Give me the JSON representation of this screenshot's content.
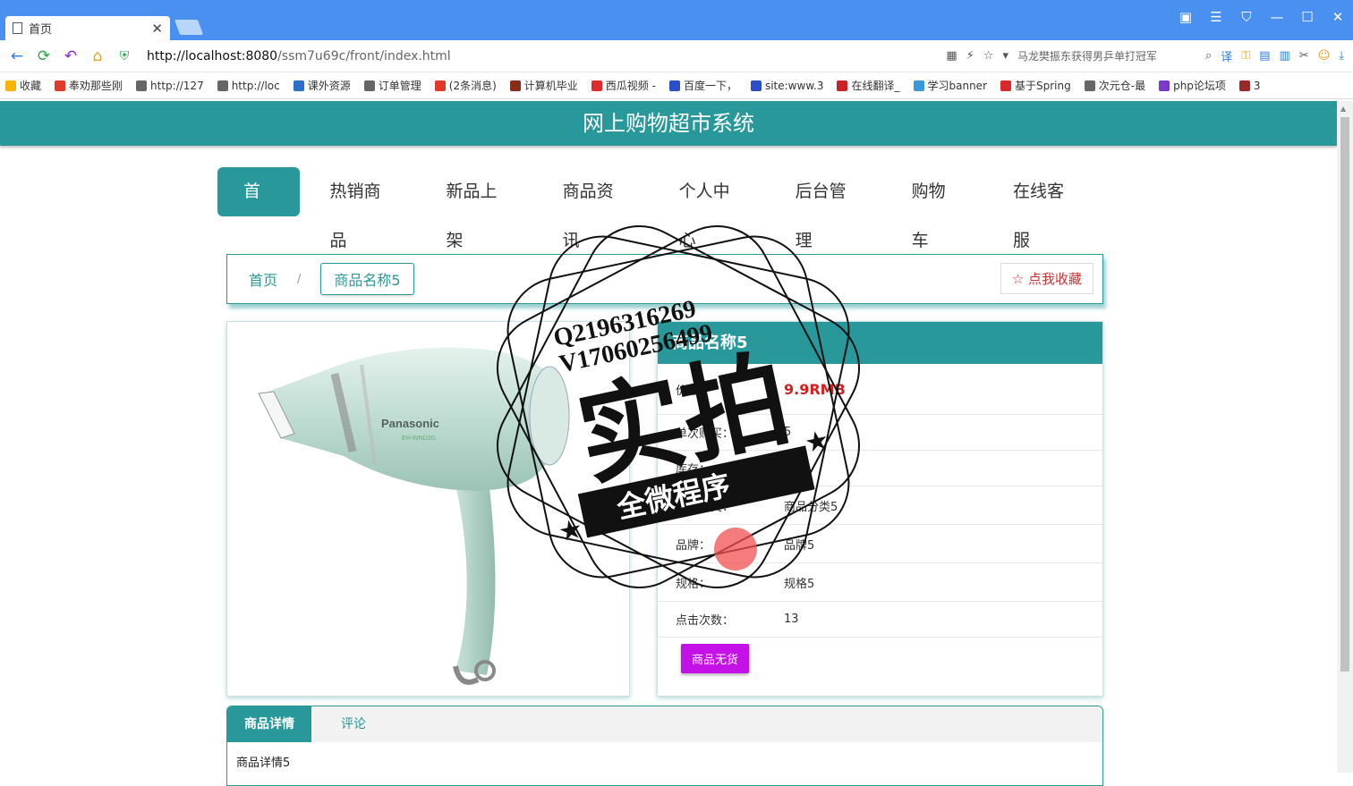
{
  "browser": {
    "tab_title": "首页",
    "url_host": "http://localhost:8080",
    "url_path": "/ssm7u69c/front/index.html",
    "search_text": "马龙樊振东获得男乒单打冠军"
  },
  "bookmarks": [
    {
      "label": "收藏",
      "color": "#f5b400"
    },
    {
      "label": "奉劝那些刚",
      "color": "#e03a2a"
    },
    {
      "label": "http://127",
      "color": "#666666"
    },
    {
      "label": "http://loc",
      "color": "#666666"
    },
    {
      "label": "课外资源",
      "color": "#2a6fc9"
    },
    {
      "label": "订单管理",
      "color": "#666666"
    },
    {
      "label": "(2条消息)",
      "color": "#e03a2a"
    },
    {
      "label": "计算机毕业",
      "color": "#8a2a1a"
    },
    {
      "label": "西瓜视频 -",
      "color": "#e02a2a"
    },
    {
      "label": "百度一下，",
      "color": "#2a4fc9"
    },
    {
      "label": "site:www.3",
      "color": "#2a4fc9"
    },
    {
      "label": "在线翻译_",
      "color": "#c9202a"
    },
    {
      "label": "学习banner",
      "color": "#3a9ad9"
    },
    {
      "label": "基于Spring",
      "color": "#d92a2a"
    },
    {
      "label": "次元仓-最",
      "color": "#666666"
    },
    {
      "label": "php论坛项",
      "color": "#7a3ac9"
    },
    {
      "label": "3",
      "color": "#9a2a2a"
    }
  ],
  "site": {
    "title": "网上购物超市系统"
  },
  "nav": [
    {
      "label": "首页",
      "active": true
    },
    {
      "label": "热销商品",
      "active": false
    },
    {
      "label": "新品上架",
      "active": false
    },
    {
      "label": "商品资讯",
      "active": false
    },
    {
      "label": "个人中心",
      "active": false
    },
    {
      "label": "后台管理",
      "active": false
    },
    {
      "label": "购物车",
      "active": false
    },
    {
      "label": "在线客服",
      "active": false
    }
  ],
  "breadcrumb": {
    "home": "首页",
    "separator": "/",
    "current": "商品名称5",
    "favorite": "☆ 点我收藏"
  },
  "product": {
    "title": "商品名称5",
    "image_brand": "Panasonic",
    "image_model": "EH-WND2G",
    "rows": [
      {
        "label": "价格：",
        "value": "9.9RMB",
        "price": true
      },
      {
        "label": "单次购买：",
        "value": "5"
      },
      {
        "label": "库存：",
        "value": "0"
      },
      {
        "label": "商品分类：",
        "value": "商品分类5"
      },
      {
        "label": "品牌：",
        "value": "品牌5"
      },
      {
        "label": "规格：",
        "value": "规格5"
      },
      {
        "label": "点击次数：",
        "value": "13"
      }
    ],
    "buy_button": "商品无货"
  },
  "tabs": {
    "items": [
      "商品详情",
      "评论"
    ],
    "body": "商品详情5"
  },
  "watermark": {
    "line1": "Q2196316269",
    "line2": "V17060256499",
    "main": "实拍",
    "banner": "全微程序"
  }
}
